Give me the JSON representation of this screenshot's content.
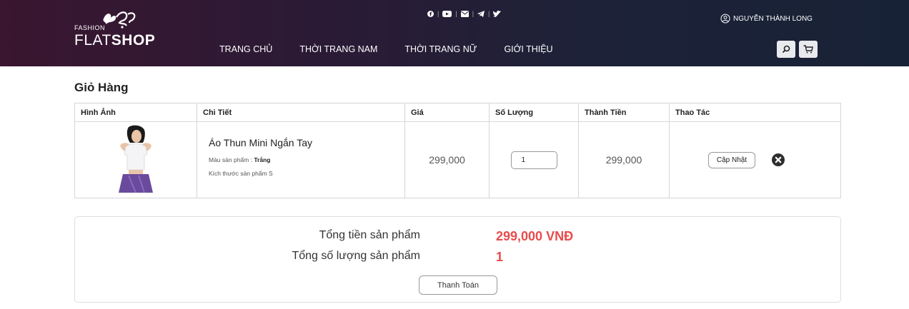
{
  "header": {
    "logo_small": "FASHION",
    "logo_light": "FLAT",
    "logo_bold": "SHOP",
    "user_name": "NGUYỄN THÀNH LONG",
    "nav": [
      "TRANG CHỦ",
      "THỜI TRANG NAM",
      "THỜI TRANG NỮ",
      "GIỚI THIỆU"
    ],
    "social_icons": [
      "facebook-icon",
      "youtube-icon",
      "email-icon",
      "telegram-icon",
      "twitter-icon"
    ]
  },
  "cart": {
    "title": "Giỏ Hàng",
    "columns": [
      "Hình Ảnh",
      "Chi Tiết",
      "Giá",
      "Số Lượng",
      "Thành Tiền",
      "Thao Tác"
    ],
    "item": {
      "name": "Áo Thun Mini Ngắn Tay",
      "color_label": "Màu sản phẩm : ",
      "color_value": "Trắng",
      "size_text": "Kích thước sản phẩm S",
      "price": "299,000",
      "quantity": "1",
      "total": "299,000",
      "update_label": "Cập Nhật"
    }
  },
  "summary": {
    "total_label": "Tổng tiền sản phẩm",
    "total_value": "299,000 VNĐ",
    "count_label": "Tổng số lượng sản phẩm",
    "count_value": "1",
    "checkout_label": "Thanh Toán"
  },
  "colors": {
    "accent_red": "#e94b4b",
    "header_dark": "#2b1a35"
  }
}
